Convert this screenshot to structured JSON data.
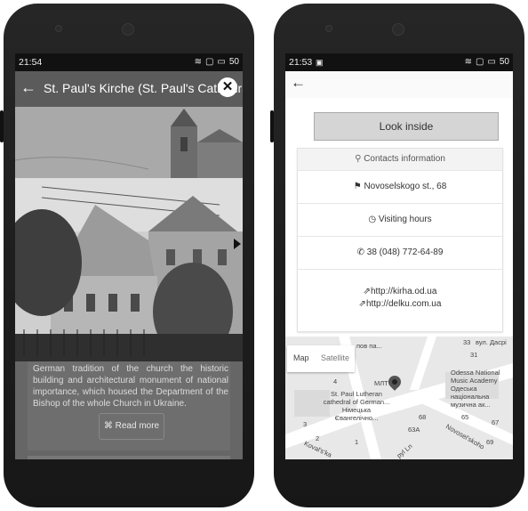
{
  "left_phone": {
    "status": {
      "time": "21:54",
      "battery": "50"
    },
    "app_bar": {
      "title": "St. Paul's Kirche (St. Paul's Cathedral)"
    },
    "description": "German tradition of the church the historic building and architectural monument of national importance, which housed the Department of the Bishop of the whole Church in Ukraine.",
    "read_more": "⌘ Read more"
  },
  "right_phone": {
    "status": {
      "time": "21:53",
      "battery": "50"
    },
    "look_inside": "Look inside",
    "contacts": {
      "header": "Contacts information",
      "address": "Novoselskogo st., 68",
      "visiting_hours": "Visiting hours",
      "phone": "38 (048) 772-64-89",
      "links": [
        "http://kirha.od.ua",
        "http://delku.com.ua"
      ]
    },
    "map": {
      "map_tab": "Map",
      "satellite_tab": "Satellite",
      "labels": {
        "cathedral": "St. Paul Lutheran cathedral of German...",
        "cathedral_local": "Німецька Євангелічно...",
        "academy": "Odessa National Music Academy",
        "academy_local": "Одеська національна музична ак...",
        "street_novoselskoho": "Novosel'skoho",
        "street_koval": "Koval's'ka",
        "lane": "pyl Ln",
        "dasp": "вул. Дасрі",
        "poi_cut": "пов па...",
        "num_4": "4",
        "num_2": "2",
        "num_3": "3",
        "num_1": "1",
        "num_68": "68",
        "num_65": "65",
        "num_67": "67",
        "num_69": "69",
        "num_63a": "63A",
        "num_33": "33",
        "num_31": "31",
        "mlt": "МЛТ"
      }
    }
  }
}
